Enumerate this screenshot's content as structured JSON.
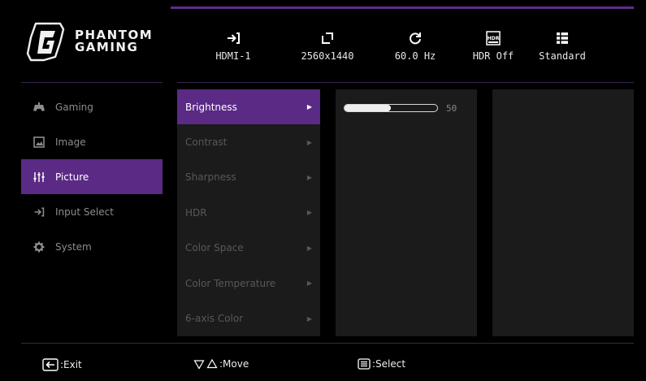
{
  "brand": {
    "line1": "PHANTOM",
    "line2": "GAMING"
  },
  "status_bar": [
    {
      "icon": "input-arrow-icon",
      "value": "HDMI-1"
    },
    {
      "icon": "resolution-icon",
      "value": "2560x1440"
    },
    {
      "icon": "refresh-icon",
      "value": "60.0 Hz"
    },
    {
      "icon": "hdr-icon",
      "icon_label": "HDR",
      "value": "HDR Off"
    },
    {
      "icon": "list-mode-icon",
      "value": "Standard"
    }
  ],
  "sidebar": {
    "items": [
      {
        "label": "Gaming",
        "icon": "gamepad-icon",
        "active": false
      },
      {
        "label": "Image",
        "icon": "image-icon",
        "active": false
      },
      {
        "label": "Picture",
        "icon": "sliders-icon",
        "active": true
      },
      {
        "label": "Input Select",
        "icon": "input-arrow-icon",
        "active": false
      },
      {
        "label": "System",
        "icon": "gear-icon",
        "active": false
      }
    ]
  },
  "submenu": {
    "items": [
      {
        "label": "Brightness",
        "active": true
      },
      {
        "label": "Contrast",
        "active": false
      },
      {
        "label": "Sharpness",
        "active": false
      },
      {
        "label": "HDR",
        "active": false
      },
      {
        "label": "Color Space",
        "active": false
      },
      {
        "label": "Color Temperature",
        "active": false
      },
      {
        "label": "6-axis Color",
        "active": false
      }
    ]
  },
  "brightness": {
    "value": "50",
    "fraction": 0.5
  },
  "footer": {
    "exit_label": ":Exit",
    "move_label": ":Move",
    "select_label": ":Select"
  },
  "colors": {
    "accent": "#5a2a85",
    "panel": "#1b1b1b",
    "background": "#000000"
  }
}
